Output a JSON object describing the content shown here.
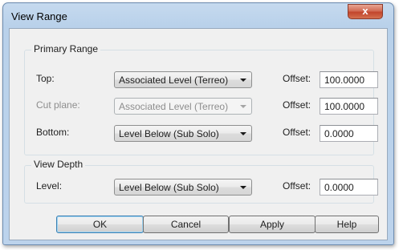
{
  "window": {
    "title": "View Range",
    "close_glyph": "x"
  },
  "primary_range": {
    "label": "Primary Range",
    "rows": [
      {
        "label": "Top:",
        "select_value": "Associated Level (Terreo)",
        "enabled": true,
        "offset_label": "Offset:",
        "offset_value": "100.0000"
      },
      {
        "label": "Cut plane:",
        "select_value": "Associated Level (Terreo)",
        "enabled": false,
        "offset_label": "Offset:",
        "offset_value": "100.0000"
      },
      {
        "label": "Bottom:",
        "select_value": "Level Below (Sub Solo)",
        "enabled": true,
        "offset_label": "Offset:",
        "offset_value": "0.0000"
      }
    ]
  },
  "view_depth": {
    "label": "View Depth",
    "rows": [
      {
        "label": "Level:",
        "select_value": "Level Below (Sub Solo)",
        "enabled": true,
        "offset_label": "Offset:",
        "offset_value": "0.0000"
      }
    ]
  },
  "buttons": {
    "ok": "OK",
    "cancel": "Cancel",
    "apply": "Apply",
    "help": "Help"
  }
}
